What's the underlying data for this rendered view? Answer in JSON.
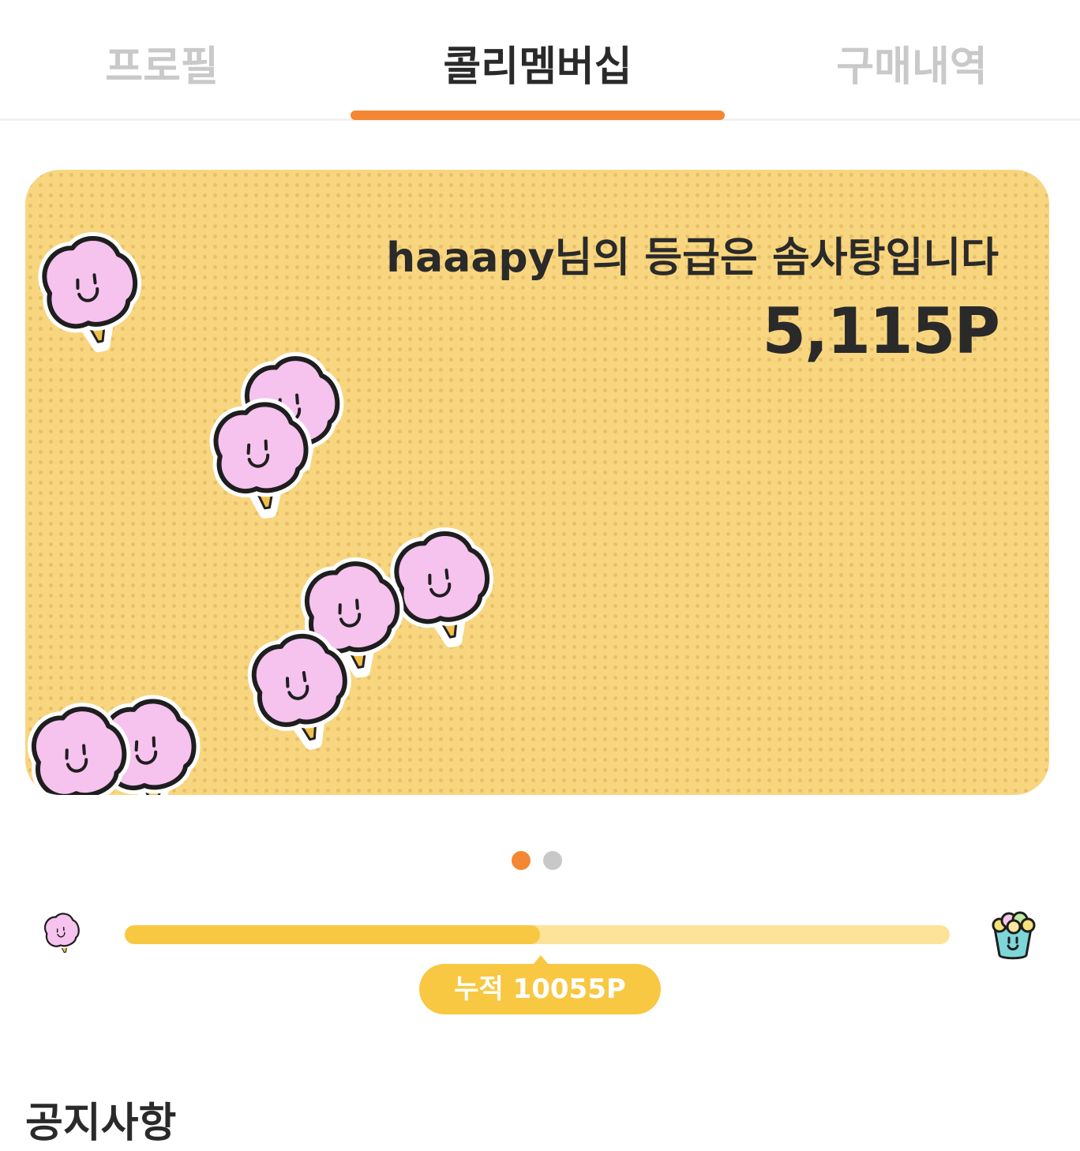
{
  "tabs": [
    {
      "label": "프로필",
      "active": false
    },
    {
      "label": "콜리멤버십",
      "active": true
    },
    {
      "label": "구매내역",
      "active": false
    }
  ],
  "colors": {
    "accent": "#f48733",
    "card_bg": "#f8d67f",
    "progress_fill": "#f8c842",
    "progress_track": "#fde299",
    "candy_pink": "#f6c2ee"
  },
  "card": {
    "headline": "haaapy님의 등급은 솜사탕입니다",
    "points": "5,115P",
    "decoration_icon": "cotton-candy-icon"
  },
  "pagination": {
    "current": 1,
    "total": 2
  },
  "progress": {
    "start_icon": "cotton-candy-icon",
    "end_icon": "popcorn-cup-icon",
    "fill_fraction": 0.503,
    "label": "누적 10055P"
  },
  "notice": {
    "title": "공지사항"
  }
}
